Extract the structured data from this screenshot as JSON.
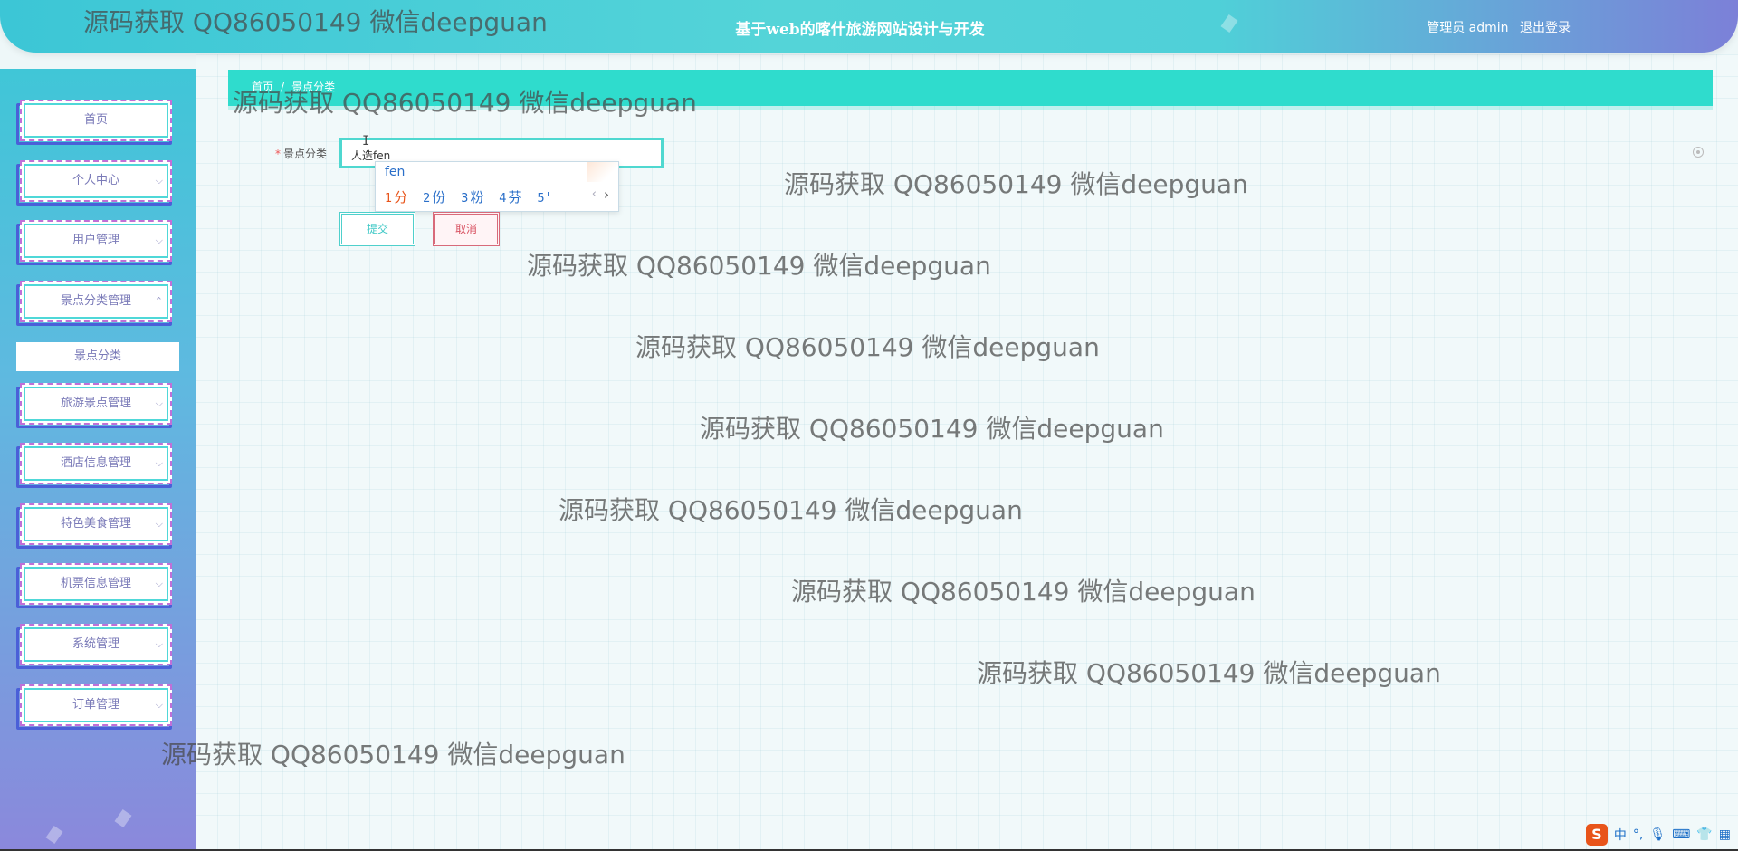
{
  "header": {
    "site_title": "基于web的喀什旅游网站设计与开发",
    "user_role": "管理员 admin",
    "logout_label": "退出登录"
  },
  "sidebar": {
    "items": [
      {
        "label": "首页",
        "chevron": ""
      },
      {
        "label": "个人中心",
        "chevron": "⌵"
      },
      {
        "label": "用户管理",
        "chevron": "⌵"
      },
      {
        "label": "景点分类管理",
        "chevron": "⌃"
      },
      {
        "label": "旅游景点管理",
        "chevron": "⌵"
      },
      {
        "label": "酒店信息管理",
        "chevron": "⌵"
      },
      {
        "label": "特色美食管理",
        "chevron": "⌵"
      },
      {
        "label": "机票信息管理",
        "chevron": "⌵"
      },
      {
        "label": "系统管理",
        "chevron": "⌵"
      },
      {
        "label": "订单管理",
        "chevron": "⌵"
      }
    ],
    "active_subitem": "景点分类"
  },
  "breadcrumb": {
    "home": "首页",
    "separator": "/",
    "current": "景点分类"
  },
  "form": {
    "field_label": "景点分类",
    "required_mark": "*",
    "field_value": "人造fen",
    "submit_label": "提交",
    "cancel_label": "取消"
  },
  "ime": {
    "composition": "fen",
    "candidates": [
      {
        "num": "1",
        "text": "分"
      },
      {
        "num": "2",
        "text": "份"
      },
      {
        "num": "3",
        "text": "粉"
      },
      {
        "num": "4",
        "text": "芬"
      },
      {
        "num": "5",
        "text": "'"
      }
    ],
    "prev": "‹",
    "next": "›",
    "tray": {
      "logo": "S",
      "mode": "中",
      "punct": "°,"
    }
  },
  "watermark_text": "源码获取 QQ86050149 微信deepguan",
  "colors": {
    "accent": "#2fdccd",
    "submit": "#3ec8c6",
    "cancel": "#d85060",
    "sidebar_top": "#40c6d7",
    "sidebar_bottom": "#8b88dc"
  }
}
